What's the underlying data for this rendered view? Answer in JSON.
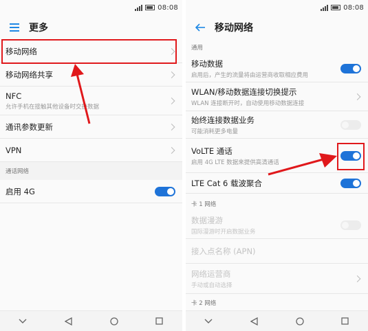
{
  "status": {
    "time": "08:08"
  },
  "left": {
    "title": "更多",
    "items": [
      {
        "title": "移动网络",
        "sub": ""
      },
      {
        "title": "移动网络共享",
        "sub": ""
      },
      {
        "title": "NFC",
        "sub": "允许手机在接触其他设备时交换数据"
      },
      {
        "title": "通讯参数更新",
        "sub": ""
      },
      {
        "title": "VPN",
        "sub": ""
      }
    ],
    "section_label": "通话网络",
    "toggle_item": {
      "title": "启用 4G",
      "on": true
    }
  },
  "right": {
    "title": "移动网络",
    "section_general": "通用",
    "items": [
      {
        "title": "移动数据",
        "sub": "启用后，产生的流量将由运营商收取相应费用",
        "on": true
      },
      {
        "title": "WLAN/移动数据连接切换提示",
        "sub": "WLAN 连接断开时，自动使用移动数据连接"
      },
      {
        "title": "始终连接数据业务",
        "sub": "可能消耗更多电量",
        "on": false
      },
      {
        "title": "VoLTE 通话",
        "sub": "启用 4G LTE 数据来提供高清通话",
        "on": true
      },
      {
        "title": "LTE Cat 6 载波聚合",
        "sub": "",
        "on": true
      }
    ],
    "section_sim1": "卡 1 网络",
    "sim1_items": [
      {
        "title": "数据漫游",
        "sub": "国际漫游时开启数据业务"
      },
      {
        "title": "接入点名称 (APN)",
        "sub": ""
      },
      {
        "title": "网络运营商",
        "sub": "手动或自动选择"
      }
    ],
    "section_sim2": "卡 2 网络"
  },
  "colors": {
    "accent": "#1e73d8",
    "highlight": "#e0181b"
  }
}
